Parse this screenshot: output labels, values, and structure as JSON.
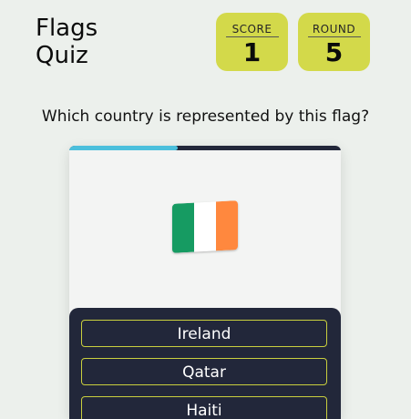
{
  "header": {
    "title_line1": "Flags",
    "title_line2": "Quiz"
  },
  "score": {
    "label": "SCORE",
    "value": "1"
  },
  "round": {
    "label": "ROUND",
    "value": "5"
  },
  "question": "Which country is represented by this flag?",
  "progress": {
    "fraction": 0.4
  },
  "flag": {
    "colors": [
      "#169b62",
      "#ffffff",
      "#ff883e"
    ]
  },
  "answers": [
    {
      "label": "Ireland"
    },
    {
      "label": "Qatar"
    },
    {
      "label": "Haiti"
    }
  ],
  "colors": {
    "background": "#ecf0ec",
    "accent": "#d3d94a",
    "panel": "#22273a",
    "progress": "#4bbfdc"
  }
}
